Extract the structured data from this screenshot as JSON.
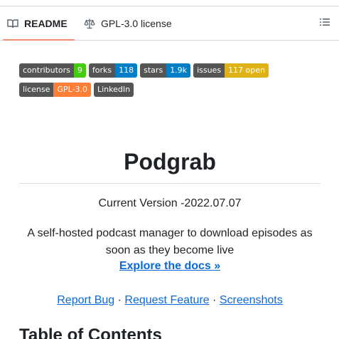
{
  "tabs": {
    "readme_label": "README",
    "license_label": "GPL-3.0 license"
  },
  "badges_row1": [
    {
      "label": "contributors",
      "value": "9",
      "color": "#4c1"
    },
    {
      "label": "forks",
      "value": "118",
      "color": "#007ec6"
    },
    {
      "label": "stars",
      "value": "1.9k",
      "color": "#007ec6"
    },
    {
      "label": "issues",
      "value": "117 open",
      "color": "#dfb317"
    }
  ],
  "badges_row2": [
    {
      "label": "license",
      "value": "GPL-3.0",
      "color": "#fe7d37"
    },
    {
      "label": "LinkedIn",
      "value": "",
      "color": "#555555"
    }
  ],
  "content": {
    "title": "Podgrab",
    "version": "Current Version -2022.07.07",
    "description": "A self-hosted podcast manager to download episodes as soon as they become live",
    "explore": "Explore the docs »",
    "report_bug": "Report Bug",
    "request_feature": "Request Feature",
    "screenshots": "Screenshots",
    "separator": " · ",
    "toc_heading": "Table of Contents"
  },
  "colors": {
    "link": "#0969da",
    "tab_underline": "#fd8c73",
    "border": "#d0d7de"
  }
}
